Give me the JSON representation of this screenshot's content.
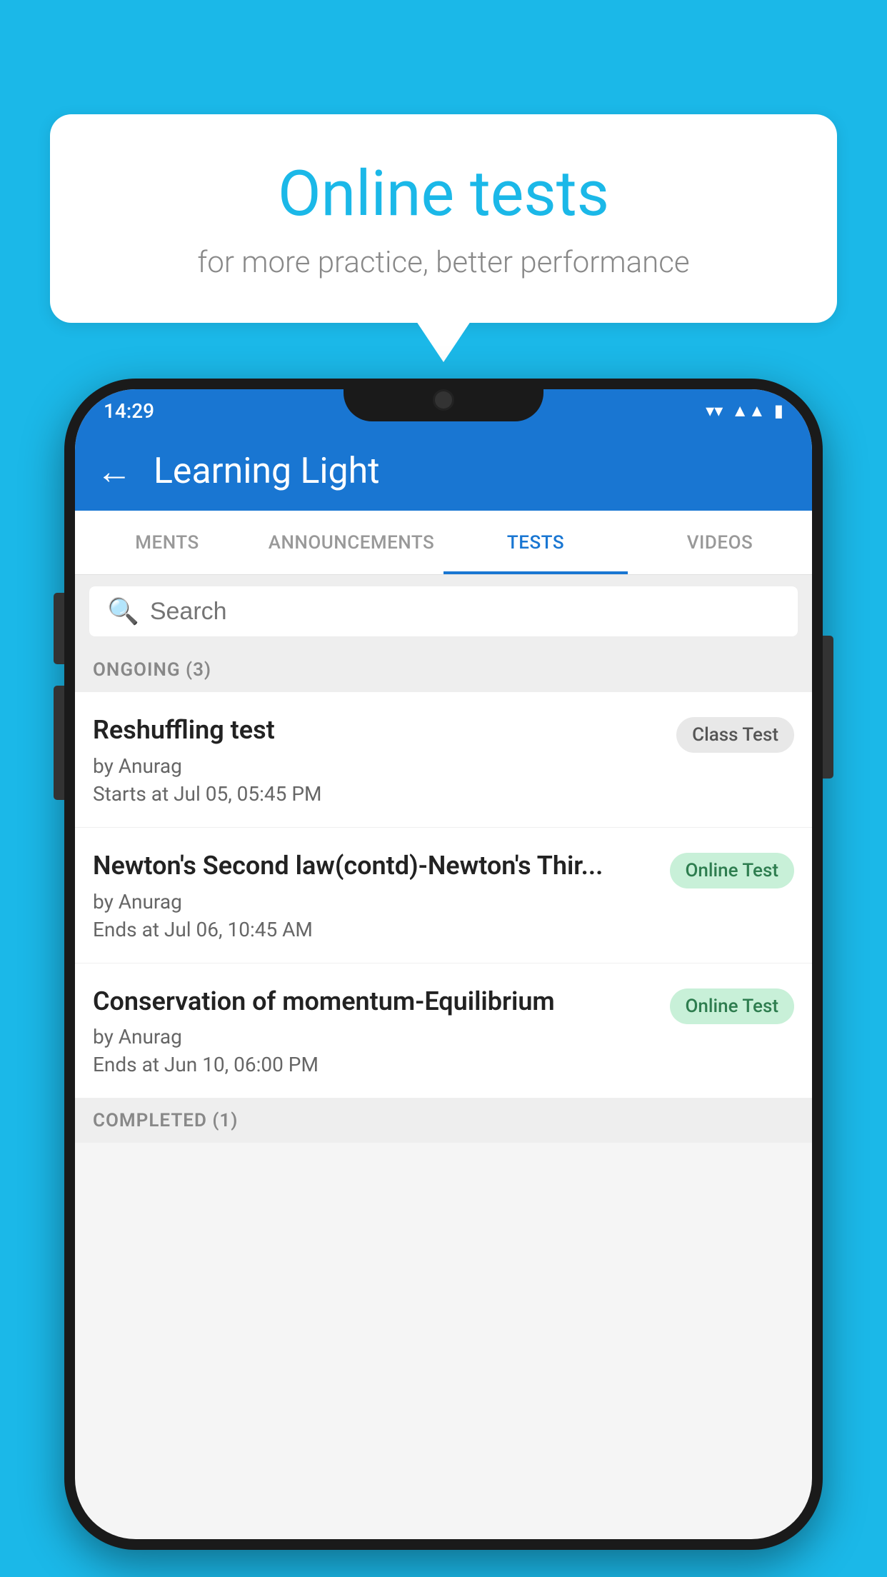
{
  "background": {
    "color": "#1bb8e8"
  },
  "speech_bubble": {
    "title": "Online tests",
    "subtitle": "for more practice, better performance"
  },
  "phone": {
    "status_bar": {
      "time": "14:29",
      "wifi": "▼",
      "signal": "▲",
      "battery": "▮"
    },
    "app_bar": {
      "title": "Learning Light",
      "back_label": "←"
    },
    "tabs": [
      {
        "label": "MENTS",
        "active": false
      },
      {
        "label": "ANNOUNCEMENTS",
        "active": false
      },
      {
        "label": "TESTS",
        "active": true
      },
      {
        "label": "VIDEOS",
        "active": false
      }
    ],
    "search": {
      "placeholder": "Search"
    },
    "ongoing_section": {
      "header": "ONGOING (3)",
      "items": [
        {
          "name": "Reshuffling test",
          "author": "by Anurag",
          "date": "Starts at  Jul 05, 05:45 PM",
          "badge": "Class Test",
          "badge_type": "class"
        },
        {
          "name": "Newton's Second law(contd)-Newton's Thir...",
          "author": "by Anurag",
          "date": "Ends at  Jul 06, 10:45 AM",
          "badge": "Online Test",
          "badge_type": "online"
        },
        {
          "name": "Conservation of momentum-Equilibrium",
          "author": "by Anurag",
          "date": "Ends at  Jun 10, 06:00 PM",
          "badge": "Online Test",
          "badge_type": "online"
        }
      ]
    },
    "completed_section": {
      "header": "COMPLETED (1)"
    }
  }
}
